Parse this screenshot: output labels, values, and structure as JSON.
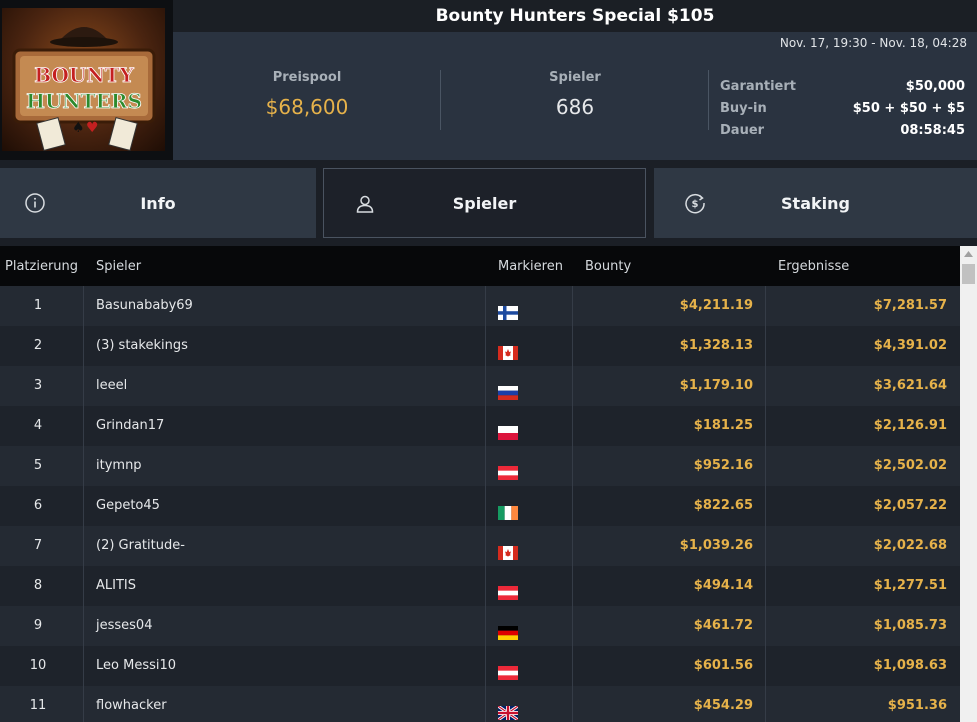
{
  "tournament": {
    "title": "Bounty Hunters Special $105",
    "date_range": "Nov. 17, 19:30 - Nov. 18, 04:28",
    "logo": {
      "lines": [
        "BOUNTY",
        "HUNTERS"
      ],
      "icon": "bounty-hunters-logo"
    }
  },
  "stats": {
    "prize_pool_label": "Preispool",
    "prize_pool_value": "$68,600",
    "players_label": "Spieler",
    "players_value": "686"
  },
  "details": [
    {
      "label": "Garantiert",
      "value": "$50,000"
    },
    {
      "label": "Buy-in",
      "value": "$50 + $50 + $5"
    },
    {
      "label": "Dauer",
      "value": "08:58:45"
    }
  ],
  "tabs": [
    {
      "label": "Info",
      "icon": "info-icon"
    },
    {
      "label": "Spieler",
      "icon": "user-icon",
      "active": true
    },
    {
      "label": "Staking",
      "icon": "dollar-circle-icon"
    }
  ],
  "table": {
    "headers": [
      "Platzierung",
      "Spieler",
      "Markieren",
      "Bounty",
      "Ergebnisse"
    ],
    "rows": [
      {
        "rank": "1",
        "name": "Basunababy69",
        "flag": "fi",
        "bounty": "$4,211.19",
        "result": "$7,281.57"
      },
      {
        "rank": "2",
        "name": "(3) stakekings",
        "flag": "ca",
        "bounty": "$1,328.13",
        "result": "$4,391.02"
      },
      {
        "rank": "3",
        "name": "leeel",
        "flag": "ru",
        "bounty": "$1,179.10",
        "result": "$3,621.64"
      },
      {
        "rank": "4",
        "name": "Grindan17",
        "flag": "pl",
        "bounty": "$181.25",
        "result": "$2,126.91"
      },
      {
        "rank": "5",
        "name": "itymnp",
        "flag": "at",
        "bounty": "$952.16",
        "result": "$2,502.02"
      },
      {
        "rank": "6",
        "name": "Gepeto45",
        "flag": "ie",
        "bounty": "$822.65",
        "result": "$2,057.22"
      },
      {
        "rank": "7",
        "name": "(2) Gratitude-",
        "flag": "ca",
        "bounty": "$1,039.26",
        "result": "$2,022.68"
      },
      {
        "rank": "8",
        "name": "ALITIS",
        "flag": "at",
        "bounty": "$494.14",
        "result": "$1,277.51"
      },
      {
        "rank": "9",
        "name": "jesses04",
        "flag": "de",
        "bounty": "$461.72",
        "result": "$1,085.73"
      },
      {
        "rank": "10",
        "name": "Leo Messi10",
        "flag": "at",
        "bounty": "$601.56",
        "result": "$1,098.63"
      },
      {
        "rank": "11",
        "name": "flowhacker",
        "flag": "gb",
        "bounty": "$454.29",
        "result": "$951.36"
      }
    ]
  },
  "colors": {
    "accent_gold": "#e6b24a",
    "header_bg": "#2a3340",
    "active_tab_border": "#4a5360"
  }
}
